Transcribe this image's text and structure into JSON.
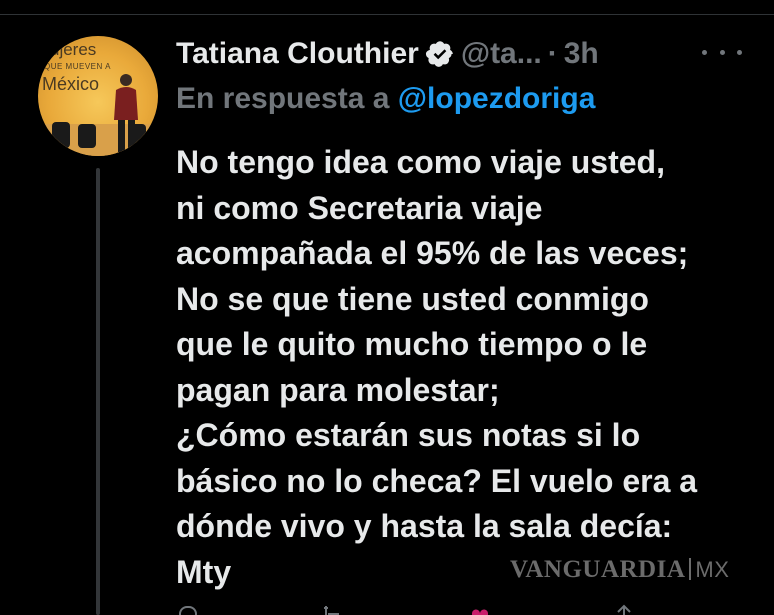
{
  "tweet": {
    "author_name": "Tatiana Clouthier",
    "handle": "@ta...",
    "separator": "·",
    "time": "3h",
    "reply_prefix": "En respuesta a",
    "reply_to": "@lopezdoriga",
    "avatar_text": {
      "line1": "ujeres",
      "line2": "QUE MUEVEN A",
      "line3": "México"
    },
    "body_lines": [
      "No tengo idea como viaje usted,",
      "ni como Secretaria viaje",
      "acompañada el 95% de las veces;",
      "No se que tiene usted conmigo",
      "que le quito mucho tiempo o le",
      "pagan para molestar;",
      "¿Cómo estarán sus notas si lo",
      "básico no lo checa? El vuelo era a",
      "dónde vivo y hasta la sala decía:",
      "Mty"
    ]
  },
  "watermark": {
    "brand": "VANGUARDIA",
    "suffix": "MX"
  },
  "colors": {
    "background": "#000000",
    "text": "#e7e9ea",
    "muted": "#71767b",
    "link": "#1d9bf0",
    "verified_badge": "#e7e9ea"
  },
  "icons": [
    "verified-icon",
    "more-icon",
    "reply-icon",
    "retweet-icon",
    "like-icon",
    "share-icon"
  ]
}
